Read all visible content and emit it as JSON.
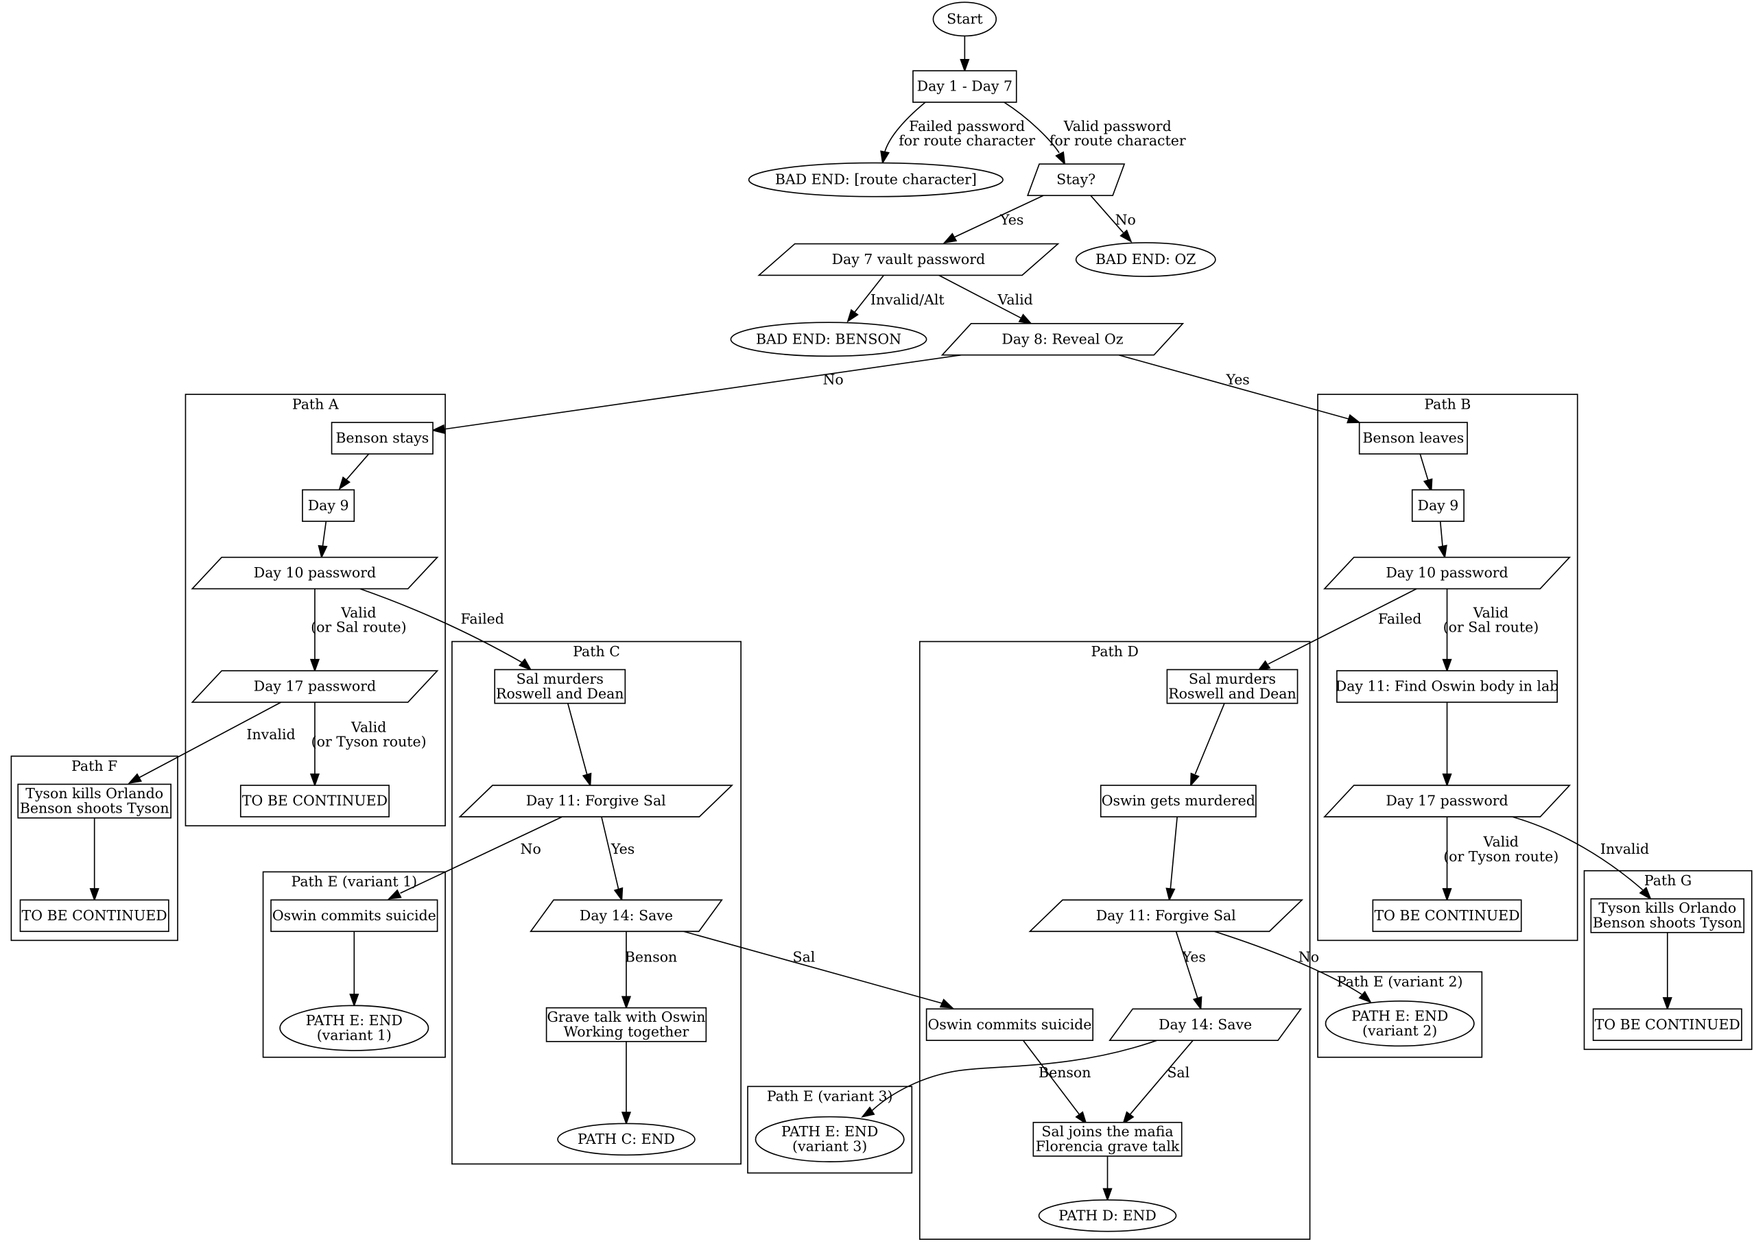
{
  "diagram": {
    "type": "flowchart",
    "clusters": {
      "A": "Path A",
      "B": "Path B",
      "C": "Path C",
      "D": "Path D",
      "E1": "Path E (variant 1)",
      "E2": "Path E (variant 2)",
      "E3": "Path E (variant 3)",
      "F": "Path F",
      "G": "Path G"
    },
    "nodes": {
      "start": [
        "Start"
      ],
      "day1_7": [
        "Day 1 - Day 7"
      ],
      "bad_route": [
        "BAD END: [route character]"
      ],
      "stay": [
        "Stay?"
      ],
      "vault": [
        "Day 7 vault password"
      ],
      "bad_oz": [
        "BAD END: OZ"
      ],
      "bad_benson": [
        "BAD END: BENSON"
      ],
      "reveal_oz": [
        "Day 8: Reveal Oz"
      ],
      "a_benson_stays": [
        "Benson stays"
      ],
      "a_day9": [
        "Day 9"
      ],
      "a_day10": [
        "Day 10 password"
      ],
      "a_day17": [
        "Day 17 password"
      ],
      "a_tbc": [
        "TO BE CONTINUED"
      ],
      "f_tyson": [
        "Tyson kills Orlando",
        "Benson shoots Tyson"
      ],
      "f_tbc": [
        "TO BE CONTINUED"
      ],
      "c_sal": [
        "Sal murders",
        "Roswell and Dean"
      ],
      "c_forgive": [
        "Day 11: Forgive Sal"
      ],
      "c_save": [
        "Day 14: Save"
      ],
      "c_grave": [
        "Grave talk with Oswin",
        "Working together"
      ],
      "c_end": [
        "PATH C: END"
      ],
      "e1_suicide": [
        "Oswin commits suicide"
      ],
      "e1_end": [
        "PATH E: END",
        "(variant 1)"
      ],
      "b_benson_leaves": [
        "Benson leaves"
      ],
      "b_day9": [
        "Day 9"
      ],
      "b_day10": [
        "Day 10 password"
      ],
      "b_day11": [
        "Day 11: Find Oswin body in lab"
      ],
      "b_day17": [
        "Day 17 password"
      ],
      "b_tbc": [
        "TO BE CONTINUED"
      ],
      "g_tyson": [
        "Tyson kills Orlando",
        "Benson shoots Tyson"
      ],
      "g_tbc": [
        "TO BE CONTINUED"
      ],
      "d_sal": [
        "Sal murders",
        "Roswell and Dean"
      ],
      "d_oswin": [
        "Oswin gets murdered"
      ],
      "d_forgive": [
        "Day 11: Forgive Sal"
      ],
      "d_suicide": [
        "Oswin commits suicide"
      ],
      "d_save": [
        "Day 14: Save"
      ],
      "d_mafia": [
        "Sal joins the mafia",
        "Florencia grave talk"
      ],
      "d_end": [
        "PATH D: END"
      ],
      "e2_end": [
        "PATH E: END",
        "(variant 2)"
      ],
      "e3_end": [
        "PATH E: END",
        "(variant 3)"
      ]
    },
    "edge_labels": {
      "failed_route": [
        "Failed password",
        "for route character"
      ],
      "valid_route": [
        "Valid password",
        "for route character"
      ],
      "stay_yes": [
        "Yes"
      ],
      "stay_no": [
        "No"
      ],
      "vault_invalid": [
        "Invalid/Alt"
      ],
      "vault_valid": [
        "Valid"
      ],
      "reveal_no": [
        "No"
      ],
      "reveal_yes": [
        "Yes"
      ],
      "a_day10_valid": [
        "Valid",
        "(or Sal route)"
      ],
      "a_day10_failed": [
        "Failed"
      ],
      "a_day17_invalid": [
        "Invalid"
      ],
      "a_day17_valid": [
        "Valid",
        "(or Tyson route)"
      ],
      "c_forgive_no": [
        "No"
      ],
      "c_forgive_yes": [
        "Yes"
      ],
      "c_save_benson": [
        "Benson"
      ],
      "c_save_sal": [
        "Sal"
      ],
      "b_day10_failed": [
        "Failed"
      ],
      "b_day10_valid": [
        "Valid",
        "(or Sal route)"
      ],
      "b_day17_valid": [
        "Valid",
        "(or Tyson route)"
      ],
      "b_day17_invalid": [
        "Invalid"
      ],
      "d_forgive_yes": [
        "Yes"
      ],
      "d_forgive_no": [
        "No"
      ],
      "d_save_benson": [
        "Benson"
      ],
      "d_save_sal": [
        "Sal"
      ]
    }
  }
}
